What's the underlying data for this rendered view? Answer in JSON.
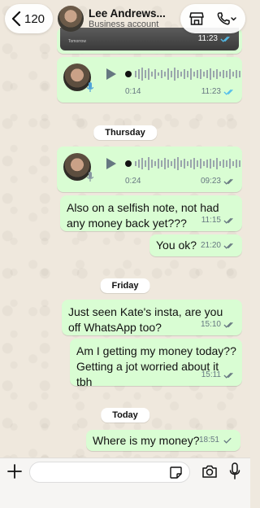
{
  "header": {
    "back_count": "120",
    "contact_name": "Lee Andrews...",
    "contact_subtitle": "Business account"
  },
  "messages": [
    {
      "kind": "image_tail",
      "time": "11:23",
      "caption": "Tomorrow"
    },
    {
      "kind": "voice",
      "duration": "0:14",
      "time": "11:23"
    },
    {
      "kind": "voice",
      "duration": "0:24",
      "time": "09:23"
    },
    {
      "kind": "text",
      "text": "Also on a selfish note, not had any money back yet???",
      "time": "11:15"
    },
    {
      "kind": "text",
      "text": "You ok?",
      "time": "21:20"
    },
    {
      "kind": "text",
      "text": "Just seen Kate's insta, are you off WhatsApp too?",
      "time": "15:10"
    },
    {
      "kind": "text",
      "text": "Am I getting my money today?? Getting a jot worried about it tbh",
      "time": "15:11"
    },
    {
      "kind": "text",
      "text": "Where is my money?",
      "time": "18:51"
    }
  ],
  "days": [
    "Thursday",
    "Friday",
    "Today"
  ],
  "composer": {
    "placeholder": ""
  },
  "colors": {
    "outgoing_bubble": "#d9fdd3",
    "read_tick": "#53bdeb",
    "delivered_tick": "#667781"
  }
}
